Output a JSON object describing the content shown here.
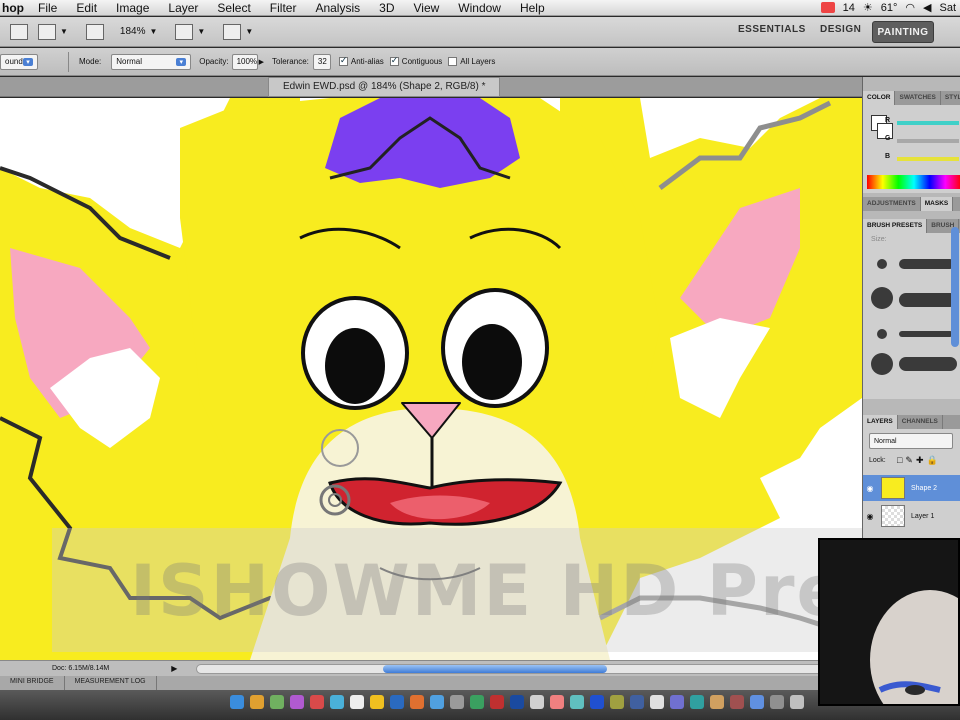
{
  "menubar": {
    "app": "hop",
    "items": [
      "File",
      "Edit",
      "Image",
      "Layer",
      "Select",
      "Filter",
      "Analysis",
      "3D",
      "View",
      "Window",
      "Help"
    ],
    "mail_badge": "14",
    "temperature": "61°",
    "clock": "Sat"
  },
  "appbar": {
    "zoom": "184%",
    "workspaces": {
      "essentials": "ESSENTIALS",
      "design": "DESIGN",
      "painting": "PAINTING"
    }
  },
  "options": {
    "fill_source": "ound",
    "mode_label": "Mode:",
    "mode_value": "Normal",
    "opacity_label": "Opacity:",
    "opacity_value": "100%",
    "tolerance_label": "Tolerance:",
    "tolerance_value": "32",
    "antialias": "Anti-alias",
    "contiguous": "Contiguous",
    "all_layers": "All Layers"
  },
  "document": {
    "tab_title": "Edwin EWD.psd @ 184% (Shape 2, RGB/8) *"
  },
  "watermark": "ISHOWME HD Preview",
  "status": {
    "doc_size": "Doc: 6.15M/8.14M"
  },
  "bottom_tabs": [
    "MINI BRIDGE",
    "MEASUREMENT LOG"
  ],
  "panels": {
    "color_tabs": [
      "COLOR",
      "SWATCHES",
      "STYLES"
    ],
    "channels": [
      "R",
      "G",
      "B"
    ],
    "adjust_tabs": [
      "ADJUSTMENTS",
      "MASKS"
    ],
    "brush_tabs": [
      "BRUSH PRESETS",
      "BRUSH"
    ],
    "brush_size_label": "Size:",
    "layers_tabs": [
      "LAYERS",
      "CHANNELS"
    ],
    "blend_mode": "Normal",
    "lock_label": "Lock:",
    "layers": [
      "Shape 2",
      "Layer 1"
    ]
  },
  "colors": {
    "fur": "#f8ec1f",
    "inner_ear": "#f7a8c0",
    "hair": "#7b3ff0",
    "mouth": "#d0232f",
    "muzzle": "#f7f3d4",
    "slider_r": "#3fd0c8",
    "slider_b": "#e6e23a"
  }
}
